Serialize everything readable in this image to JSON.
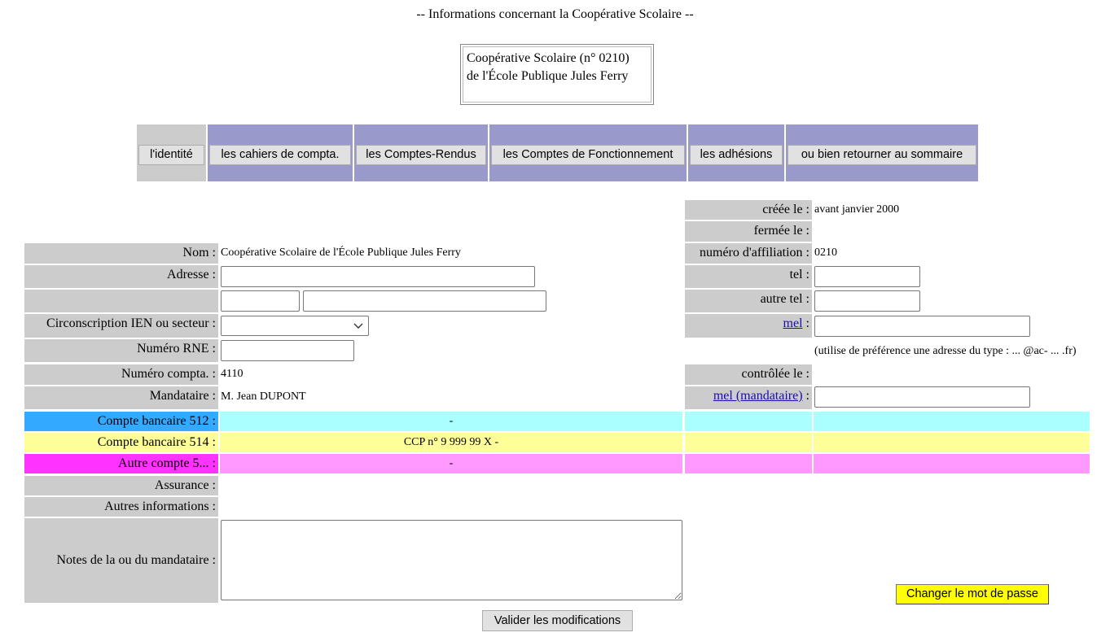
{
  "page": {
    "title": "-- Informations concernant la Coopérative Scolaire --"
  },
  "coop": {
    "line1": "Coopérative Scolaire (n° 0210)",
    "line2": "de l'École Publique Jules Ferry"
  },
  "nav": {
    "identity": "l'identité",
    "cahiers": "les cahiers de compta.",
    "comptes_rendus": "les Comptes-Rendus",
    "comptes_fonct": "les Comptes de Fonctionnement",
    "adhesions": "les adhésions",
    "retour": "ou bien retourner au sommaire"
  },
  "right": {
    "creee_label": "créée le :",
    "creee_value": "avant janvier 2000",
    "fermee_label": "fermée le :",
    "affiliation_label": "numéro d'affiliation :",
    "affiliation_value": "0210",
    "tel_label": "tel :",
    "tel_value": "",
    "autre_tel_label": "autre tel :",
    "autre_tel_value": "",
    "mel_link": "mel",
    "colon": ":",
    "mel_value": "",
    "mel_hint": "(utilise de préférence une adresse du type : ... @ac- ... .fr)",
    "controlee_label": "contrôlée le :",
    "mel_mandataire_link": "mel (mandataire)",
    "mel_mandataire_value": ""
  },
  "left": {
    "nom_label": "Nom :",
    "nom_value": "Coopérative Scolaire de l'École Publique Jules Ferry",
    "adresse_label": "Adresse :",
    "adresse_value": "",
    "cp_value": "",
    "ville_value": "",
    "circ_label": "Circonscription IEN ou secteur :",
    "circ_selected": "",
    "rne_label": "Numéro RNE :",
    "rne_value": "",
    "compta_label": "Numéro compta. :",
    "compta_value": "4110",
    "mandataire_label": "Mandataire :",
    "mandataire_value": "M. Jean DUPONT"
  },
  "accounts": {
    "b512_label": "Compte bancaire 512 :",
    "b512_value": "-",
    "b514_label": "Compte bancaire 514 :",
    "b514_value": "CCP n° 9 999 99 X -",
    "autre_label": "Autre compte 5... :",
    "autre_value": "-",
    "colors": {
      "b512_label": "#33aaff",
      "b512_row": "#aaffff",
      "b514": "#ffff99",
      "autre_label": "#ff33ff",
      "autre_row": "#ff99ff"
    }
  },
  "extra": {
    "assurance_label": "Assurance :",
    "autres_label": "Autres informations :",
    "notes_label": "Notes de la ou du mandataire :",
    "notes_value": ""
  },
  "actions": {
    "change_password": "Changer le mot de passe",
    "validate": "Valider les modifications"
  }
}
